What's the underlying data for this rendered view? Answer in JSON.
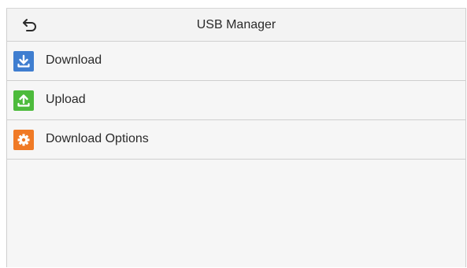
{
  "header": {
    "title": "USB Manager",
    "back_icon": "back-arrow-icon"
  },
  "menu": {
    "items": [
      {
        "label": "Download",
        "icon": "download-icon",
        "color": "#3f7ed0"
      },
      {
        "label": "Upload",
        "icon": "upload-icon",
        "color": "#4dbb3c"
      },
      {
        "label": "Download Options",
        "icon": "gear-icon",
        "color": "#f07a26"
      }
    ]
  }
}
